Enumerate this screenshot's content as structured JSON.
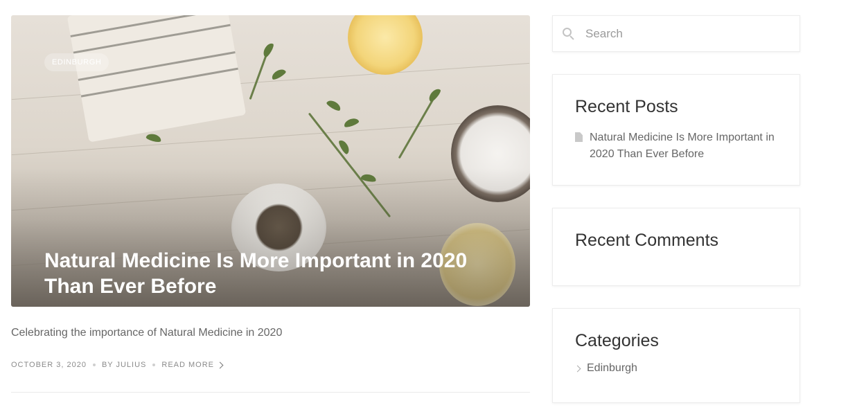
{
  "article": {
    "category_badge": "EDINBURGH",
    "title": "Natural Medicine Is More Important in 2020 Than Ever Before",
    "excerpt": "Celebrating the importance of Natural Medicine in 2020",
    "date": "OCTOBER 3, 2020",
    "author": "BY JULIUS",
    "read_more": "READ MORE"
  },
  "sidebar": {
    "search": {
      "placeholder": "Search"
    },
    "recent_posts": {
      "title": "Recent Posts",
      "items": [
        {
          "label": "Natural Medicine Is More Important in 2020 Than Ever Before"
        }
      ]
    },
    "recent_comments": {
      "title": "Recent Comments"
    },
    "categories": {
      "title": "Categories",
      "items": [
        {
          "label": "Edinburgh"
        }
      ]
    }
  },
  "icons": {
    "search": "search-icon",
    "post": "document-icon",
    "category": "chevron-right-icon",
    "read_more": "chevron-right-icon"
  }
}
